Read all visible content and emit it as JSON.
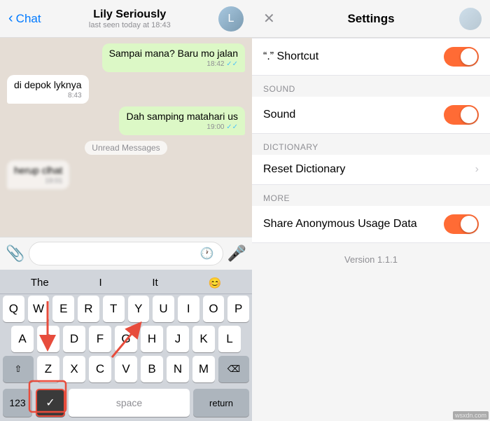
{
  "chat": {
    "back_label": "Chat",
    "contact_name": "Lily Seriously",
    "contact_status": "last seen today at 18:43",
    "avatar_initial": "L",
    "messages": [
      {
        "id": 1,
        "type": "out",
        "text": "Sampai mana? Baru mo jalan",
        "time": "18:42",
        "ticks": "✓✓",
        "blurred": false
      },
      {
        "id": 2,
        "type": "in",
        "text": "di depok lyknya",
        "time": "8:43",
        "blurred": false
      },
      {
        "id": 3,
        "type": "out",
        "text": "Dah samping matahari us",
        "time": "19:00",
        "ticks": "✓✓",
        "blurred": false
      },
      {
        "id": 4,
        "type": "divider",
        "text": "Unread Messages"
      },
      {
        "id": 5,
        "type": "in",
        "text": "herup clhat",
        "time": "19:01",
        "blurred": true
      }
    ],
    "input_placeholder": "",
    "attach_icon": "📎",
    "mic_icon": "🎤",
    "keyboard": {
      "suggestions": [
        "The",
        "I",
        "It",
        "😊"
      ],
      "row1": [
        "Q",
        "W",
        "E",
        "R",
        "T",
        "Y",
        "U",
        "I",
        "O",
        "P"
      ],
      "row2": [
        "A",
        "S",
        "D",
        "F",
        "G",
        "H",
        "J",
        "K",
        "L"
      ],
      "row3": [
        "Z",
        "X",
        "C",
        "V",
        "B",
        "N",
        "M"
      ],
      "numbers_label": "123",
      "space_label": "space",
      "return_label": "return",
      "send_icon": "✓"
    }
  },
  "settings": {
    "title": "Settings",
    "close_icon": "×",
    "sections": [
      {
        "id": "shortcuts",
        "header": "",
        "items": [
          {
            "id": "dot-shortcut",
            "label": "\".\" Shortcut",
            "type": "toggle",
            "value": true
          }
        ]
      },
      {
        "id": "sound",
        "header": "SOUND",
        "items": [
          {
            "id": "sound",
            "label": "Sound",
            "type": "toggle",
            "value": true
          }
        ]
      },
      {
        "id": "dictionary",
        "header": "DICTIONARY",
        "items": [
          {
            "id": "reset-dictionary",
            "label": "Reset Dictionary",
            "type": "chevron"
          }
        ]
      },
      {
        "id": "more",
        "header": "MORE",
        "items": [
          {
            "id": "share-usage",
            "label": "Share Anonymous Usage Data",
            "type": "toggle",
            "value": true
          }
        ]
      }
    ],
    "version": "Version 1.1.1"
  }
}
